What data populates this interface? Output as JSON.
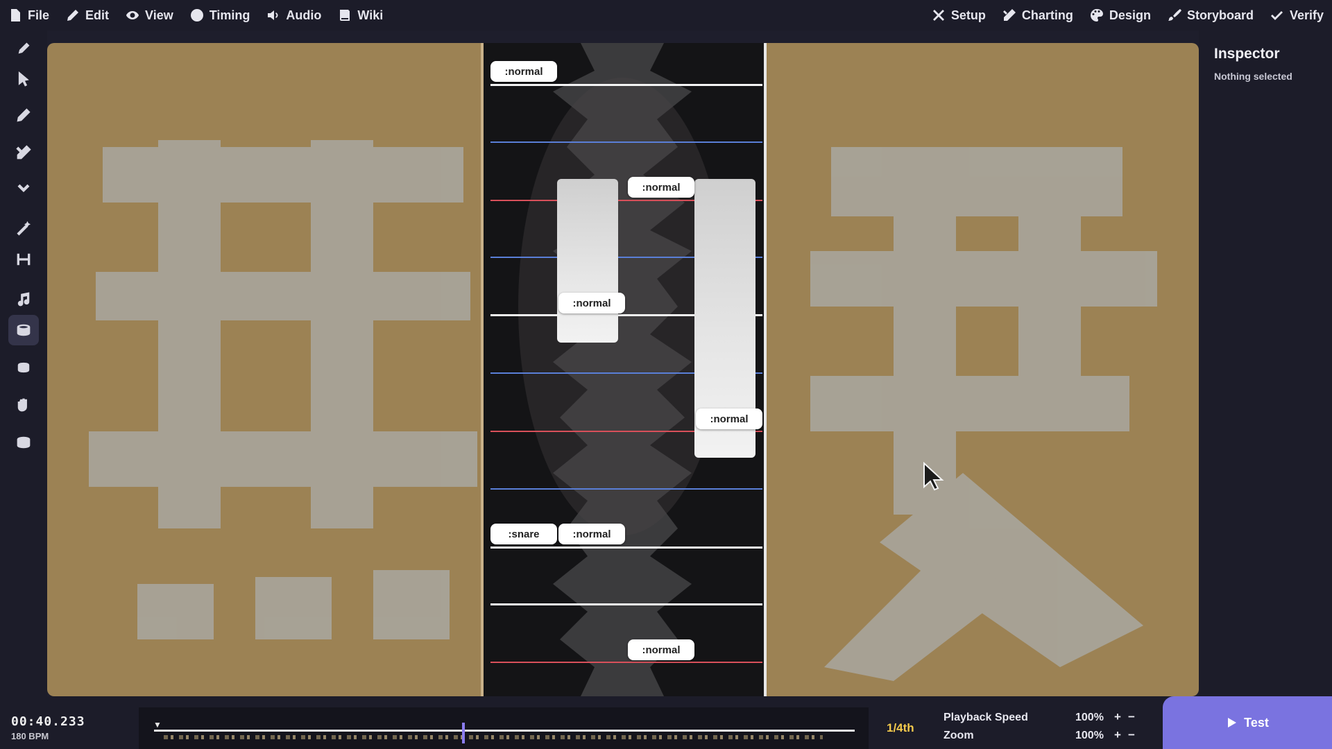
{
  "menu": {
    "left": [
      {
        "label": "File",
        "icon": "file-icon"
      },
      {
        "label": "Edit",
        "icon": "pencil-icon"
      },
      {
        "label": "View",
        "icon": "eye-icon"
      },
      {
        "label": "Timing",
        "icon": "clock-icon"
      },
      {
        "label": "Audio",
        "icon": "speaker-icon"
      },
      {
        "label": "Wiki",
        "icon": "book-icon"
      }
    ],
    "right": [
      {
        "label": "Setup",
        "icon": "tools-icon"
      },
      {
        "label": "Charting",
        "icon": "pencil-ruler-icon"
      },
      {
        "label": "Design",
        "icon": "palette-icon"
      },
      {
        "label": "Storyboard",
        "icon": "brush-icon"
      },
      {
        "label": "Verify",
        "icon": "check-double-icon"
      }
    ]
  },
  "toolbar": {
    "tools": [
      {
        "name": "edit-pencil-icon",
        "active": false
      },
      {
        "name": "select-arrow-icon",
        "active": false
      },
      {
        "name": "draw-pencil-icon",
        "active": false
      },
      {
        "name": "charting-tools-icon",
        "active": false
      },
      {
        "name": "chevron-down-icon",
        "active": false
      },
      {
        "name": "magic-wand-icon",
        "active": false
      },
      {
        "name": "width-icon",
        "active": false
      },
      {
        "name": "music-note-icon",
        "active": false
      },
      {
        "name": "drum-icon",
        "active": true
      },
      {
        "name": "drum-small-icon",
        "active": false
      },
      {
        "name": "hand-clap-icon",
        "active": false
      },
      {
        "name": "drum-alt-icon",
        "active": false
      }
    ]
  },
  "notes": {
    "n1": ":normal",
    "n2": ":normal",
    "n3": ":normal",
    "n4": ":normal",
    "n5": ":snare",
    "n6": ":normal",
    "n7": ":normal"
  },
  "inspector": {
    "title": "Inspector",
    "status": "Nothing selected"
  },
  "transport": {
    "time": "00:40.233",
    "bpm": "180 BPM",
    "snap": "1/4th",
    "playback_label": "Playback Speed",
    "playback_value": "100%",
    "zoom_label": "Zoom",
    "zoom_value": "100%",
    "plus": "+",
    "minus": "−",
    "test_label": "Test",
    "progress_fraction": 0.44
  },
  "colors": {
    "accent": "#7a73e0",
    "snap": "#f2c94c",
    "beat_blue": "#5a7fd8",
    "beat_red": "#d8505a"
  }
}
